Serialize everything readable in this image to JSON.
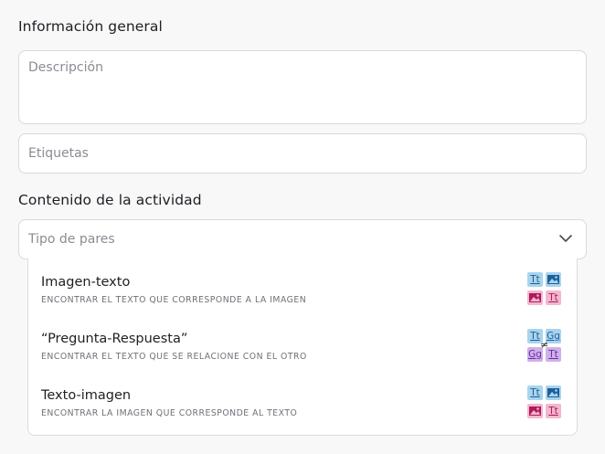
{
  "general": {
    "title": "Información general",
    "description_placeholder": "Descripción",
    "tags_placeholder": "Etiquetas"
  },
  "content": {
    "title": "Contenido de la actividad",
    "pair_type_placeholder": "Tipo de pares",
    "options": [
      {
        "title": "Imagen-texto",
        "description": "ENCONTRAR EL TEXTO QUE CORRESPONDE A LA IMAGEN",
        "icon": "image-text-pair-icon"
      },
      {
        "title": "“Pregunta-Respuesta”",
        "description": "ENCONTRAR EL TEXTO QUE SE RELACIONE CON EL OTRO",
        "icon": "question-answer-pair-icon"
      },
      {
        "title": "Texto-imagen",
        "description": "ENCONTRAR LA IMAGEN QUE CORRESPONDE AL TEXTO",
        "icon": "text-image-pair-icon"
      }
    ]
  },
  "icon_glyphs": {
    "text": "Tt",
    "letters": "Gg",
    "not_equal": "≠"
  },
  "colors": {
    "tile_blue": "#a9d4ee",
    "tile_pink": "#f3b7cf",
    "tile_purple": "#cfb1e9",
    "border": "#d9d9de"
  }
}
